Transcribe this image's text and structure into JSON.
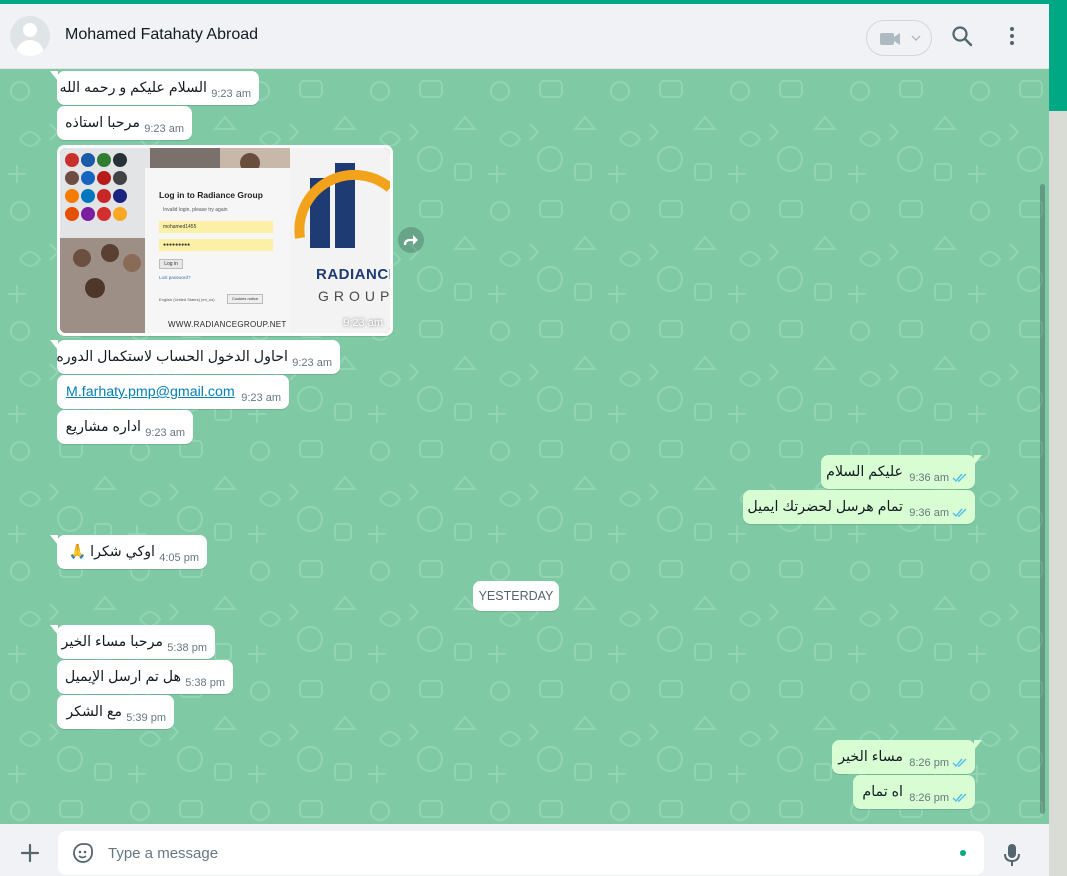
{
  "header": {
    "contact_name": "Mohamed Fatahaty Abroad",
    "icons": [
      "avatar-icon",
      "video-call-icon",
      "chevron-down-icon",
      "search-icon",
      "menu-icon"
    ]
  },
  "messages": {
    "m1": {
      "text": "السلام عليكم و رحمه الله",
      "time": "9:23 am"
    },
    "m2": {
      "text": "مرحبا استاذه",
      "time": "9:23 am"
    },
    "image": {
      "time": "9:23 am",
      "login_title": "Log in to Radiance Group",
      "login_hint": "Invalid login, please try again",
      "username": "mohamed1455",
      "password": "●●●●●●●●●",
      "login_button": "Log in",
      "lost_password": "Lost password?",
      "language": "English (United States) (en_us)",
      "cookies_button": "Cookies notice",
      "brand_top": "RADIANCE",
      "brand_bottom": "GROUP",
      "website": "WWW.RADIANCEGROUP.NET"
    },
    "m3": {
      "text": "احاول الدخول الحساب لاستكمال الدوره",
      "time": "9:23 am"
    },
    "m4": {
      "link": "M.farhaty.pmp@gmail.com",
      "time": "9:23 am"
    },
    "m5": {
      "text": "اداره مشاريع",
      "time": "9:23 am"
    },
    "o1": {
      "text": "عليكم السلام",
      "time": "9:36 am"
    },
    "o2": {
      "text": "تمام هرسل لحضرتك ايميل",
      "time": "9:36 am"
    },
    "m6": {
      "text": "اوكي شكرا 🙏",
      "time": "4:05 pm"
    },
    "date_separator": "YESTERDAY",
    "m7": {
      "text": "مرحبا مساء الخير",
      "time": "5:38 pm"
    },
    "m8": {
      "text": "هل تم ارسل الإيميل",
      "time": "5:38 pm"
    },
    "m9": {
      "text": "مع الشكر",
      "time": "5:39 pm"
    },
    "o3": {
      "text": "مساء الخير",
      "time": "8:26 pm"
    },
    "o4": {
      "text": "اه تمام",
      "time": "8:26 pm"
    }
  },
  "footer": {
    "placeholder": "Type a message",
    "icons": [
      "plus-icon",
      "sticker-icon",
      "mic-icon"
    ]
  },
  "colors": {
    "accent": "#00a884",
    "chat_bg": "#7fc9a4",
    "incoming_bubble": "#ffffff",
    "outgoing_bubble": "#d9fdd3",
    "read_tick": "#53bdeb",
    "link": "#027eb5"
  }
}
